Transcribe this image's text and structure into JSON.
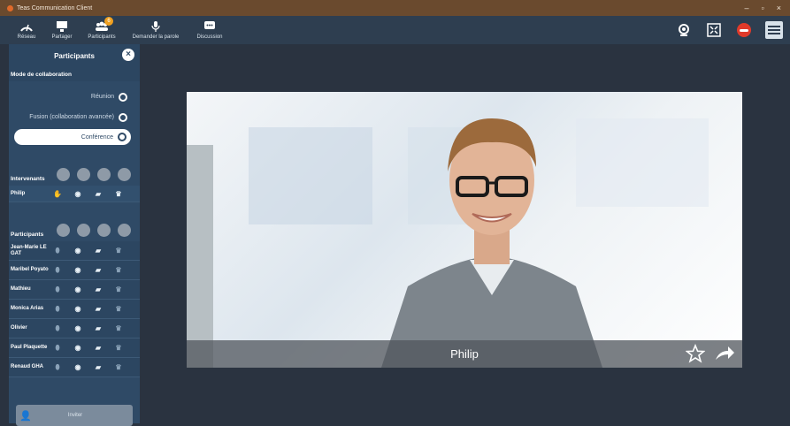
{
  "window": {
    "title": "Teas Communication Client",
    "controls": [
      "–",
      "▫",
      "×"
    ]
  },
  "toolbar": {
    "items": [
      {
        "label": "Réseau"
      },
      {
        "label": "Partager"
      },
      {
        "label": "Participants",
        "badge": "6"
      },
      {
        "label": "Demander la parole"
      },
      {
        "label": "Discussion"
      }
    ]
  },
  "sidebar": {
    "title": "Participants",
    "mode_title": "Mode de collaboration",
    "modes": [
      {
        "label": "Réunion"
      },
      {
        "label": "Fusion (collaboration avancée)"
      },
      {
        "label": "Conférence",
        "selected": true
      }
    ],
    "speakers_title": "Intervenants",
    "speakers": [
      {
        "name": "Philip"
      }
    ],
    "participants_title": "Participants",
    "participants": [
      {
        "name": "Jean-Marie LE GAT"
      },
      {
        "name": "Maribel Poyato"
      },
      {
        "name": "Mathieu"
      },
      {
        "name": "Monica Arias"
      },
      {
        "name": "Olivier"
      },
      {
        "name": "Paul Plaquette"
      },
      {
        "name": "Renaud GHA"
      }
    ],
    "invite_label": "Inviter"
  },
  "video": {
    "name": "Philip"
  },
  "colors": {
    "accent": "#2f4a66",
    "hangup": "#e03a2a",
    "badge": "#f0a020"
  }
}
